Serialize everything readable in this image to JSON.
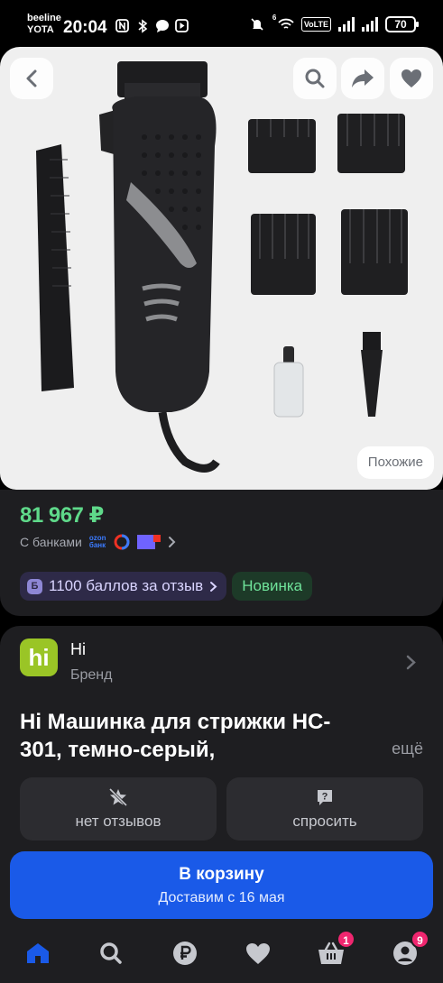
{
  "status_bar": {
    "carrier_1": "beeline",
    "carrier_2": "YOTA",
    "time": "20:04",
    "volte": "VoLTE",
    "sim_number": "6",
    "battery": "70"
  },
  "gallery": {
    "similar_label": "Похожие"
  },
  "price": {
    "value": "81 967 ₽",
    "banks_label": "С банками",
    "ozon_bank_line1": "ozon",
    "ozon_bank_line2": "банк"
  },
  "chips": {
    "points_icon": "Б",
    "points": "1100 баллов за отзыв",
    "new": "Новинка"
  },
  "brand": {
    "logo_text": "hi",
    "name": "Hi",
    "subtitle": "Бренд"
  },
  "product": {
    "title": "Hi Машинка для стрижки HC-301, темно-серый,",
    "more": "ещё"
  },
  "actions": {
    "reviews": "нет отзывов",
    "ask": "спросить"
  },
  "cart": {
    "title": "В корзину",
    "delivery": "Доставим с 16 мая"
  },
  "nav": {
    "cart_badge": "1",
    "profile_badge": "9"
  },
  "colors": {
    "price": "#5fd98a",
    "cart_button": "#1a5ae8",
    "badge": "#f0266f",
    "nav_active": "#1a5ae8"
  }
}
